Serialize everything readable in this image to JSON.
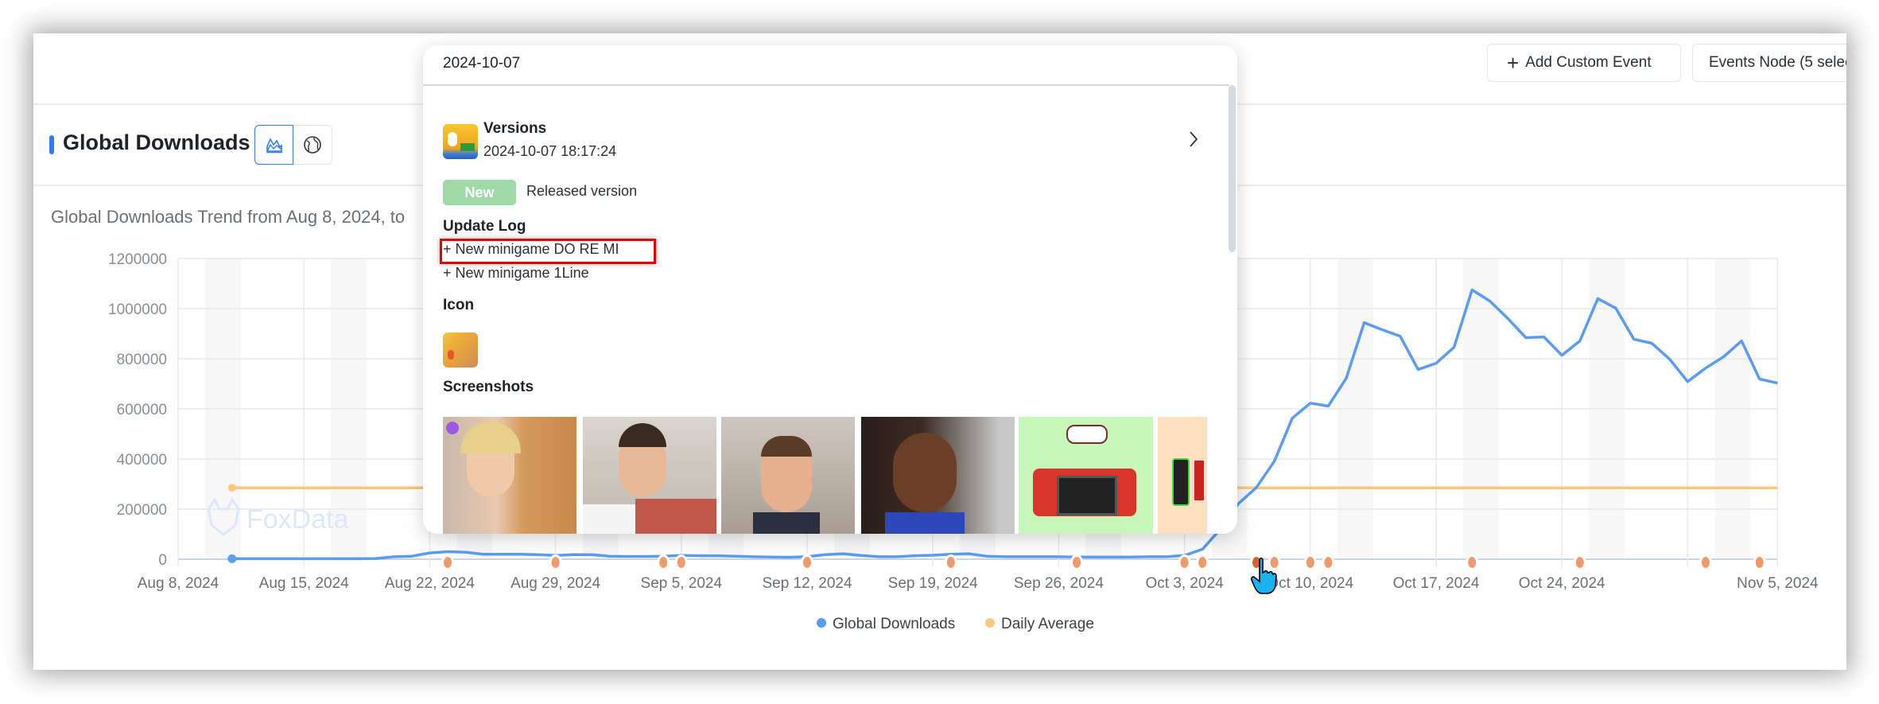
{
  "header": {
    "add_custom_event_label": "Add Custom Event",
    "events_node_label": "Events Node (5 selec"
  },
  "section": {
    "title": "Global Downloads",
    "view_toggles": [
      {
        "icon": "area-chart-icon",
        "selected": true
      },
      {
        "icon": "globe-icon",
        "selected": false
      }
    ],
    "subtitle": "Global Downloads Trend from Aug 8, 2024, to"
  },
  "watermark": "FoxData",
  "popup": {
    "date": "2024-10-07",
    "versions_title": "Versions",
    "versions_datetime": "2024-10-07 18:17:24",
    "badge": "New",
    "badge_color": "#9fd9a8",
    "released_label": "Released version",
    "update_log_title": "Update Log",
    "update_log": [
      "+ New minigame DO RE MI",
      "+ New minigame 1Line"
    ],
    "highlighted_item_color": "#e60000",
    "icon_title": "Icon",
    "screenshots_title": "Screenshots"
  },
  "chart_data": {
    "type": "line",
    "title": "",
    "xlabel": "",
    "ylabel": "",
    "ylim": [
      0,
      1200000
    ],
    "yticks": [
      "0",
      "200000",
      "400000",
      "600000",
      "800000",
      "1000000",
      "1200000"
    ],
    "xticks": [
      "Aug 8, 2024",
      "Aug 15, 2024",
      "Aug 22, 2024",
      "Aug 29, 2024",
      "Sep 5, 2024",
      "Sep 12, 2024",
      "Sep 19, 2024",
      "Sep 26, 2024",
      "Oct 3, 2024",
      "Oct 10, 2024",
      "Oct 17, 2024",
      "Oct 24, 2024",
      "Nov 5, 2024"
    ],
    "xrange": [
      "2024-08-08",
      "2024-11-05"
    ],
    "grid": true,
    "weekend_shading": true,
    "legend_position": "bottom",
    "series": [
      {
        "name": "Global Downloads",
        "color": "#5b9cf0",
        "start": "2024-08-11",
        "values": [
          2000,
          2000,
          2000,
          2000,
          2000,
          2000,
          2000,
          2000,
          3000,
          10000,
          12000,
          25000,
          30000,
          28000,
          20000,
          20000,
          20000,
          18000,
          15000,
          18000,
          18000,
          12000,
          11000,
          11000,
          12000,
          15000,
          14000,
          14000,
          12000,
          10000,
          9000,
          8000,
          10000,
          18000,
          22000,
          15000,
          10000,
          10000,
          14000,
          16000,
          20000,
          22000,
          12000,
          10000,
          10000,
          10000,
          10000,
          9000,
          9000,
          9000,
          9000,
          10000,
          10000,
          15000,
          40000,
          120000,
          222000,
          286000,
          391000,
          563000,
          623000,
          611000,
          722000,
          944000,
          916000,
          890000,
          757000,
          782000,
          846000,
          1075000,
          1030000,
          960000,
          884000,
          887000,
          814000,
          871000,
          1040000,
          1002000,
          878000,
          862000,
          798000,
          709000,
          763000,
          808000,
          871000,
          719000,
          703000
        ]
      },
      {
        "name": "Daily Average",
        "color": "#f9c97a",
        "start": "2024-08-11",
        "end": "2024-11-05",
        "value": 285000
      }
    ],
    "event_markers": {
      "color": "#ef9a6c",
      "active_color": "#d9622b",
      "active": "2024-10-07",
      "dates": [
        "2024-08-23",
        "2024-08-29",
        "2024-09-04",
        "2024-09-05",
        "2024-09-12",
        "2024-09-20",
        "2024-09-27",
        "2024-10-03",
        "2024-10-04",
        "2024-10-07",
        "2024-10-08",
        "2024-10-10",
        "2024-10-11",
        "2024-10-19",
        "2024-10-25",
        "2024-11-01",
        "2024-11-04"
      ]
    }
  }
}
